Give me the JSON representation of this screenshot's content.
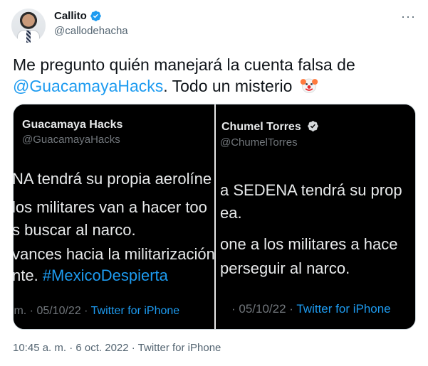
{
  "author": {
    "name": "Callito",
    "handle": "@callodehacha"
  },
  "tweet": {
    "line1": "Me pregunto quién manejará la cuenta falsa de",
    "mention": "@GuacamayaHacks",
    "line2_rest": ". Todo un misterio"
  },
  "media": {
    "left": {
      "name": "Guacamaya Hacks",
      "handle": "@GuacamayaHacks",
      "lines": [
        "NA tendrá su propia aerolíne",
        "los militares van a hacer too",
        "s buscar al narco.",
        "vances hacia la militarización"
      ],
      "last_line_prefix": "nte. ",
      "hashtag": "#MexicoDespierta",
      "meta_prefix": ".m. · 05/10/22 · ",
      "meta_app": "Twitter for iPhone"
    },
    "right": {
      "name": "Chumel Torres",
      "handle": "@ChumelTorres",
      "lines": [
        "a SEDENA tendrá su prop",
        "ea.",
        "one a los militares a hace",
        "perseguir al narco."
      ],
      "meta_prefix": "· 05/10/22 · ",
      "meta_app": "Twitter for iPhone"
    }
  },
  "footer": {
    "timestamp": "10:45 a. m. · 6 oct. 2022 · Twitter for iPhone"
  },
  "icons": {
    "verified": "verified-badge-icon",
    "more": "more-horizontal-icon",
    "emoji": "clown-face-icon"
  },
  "colors": {
    "link": "#1d9bf0",
    "secondary_text": "#536471",
    "dark_bg": "#000000"
  }
}
